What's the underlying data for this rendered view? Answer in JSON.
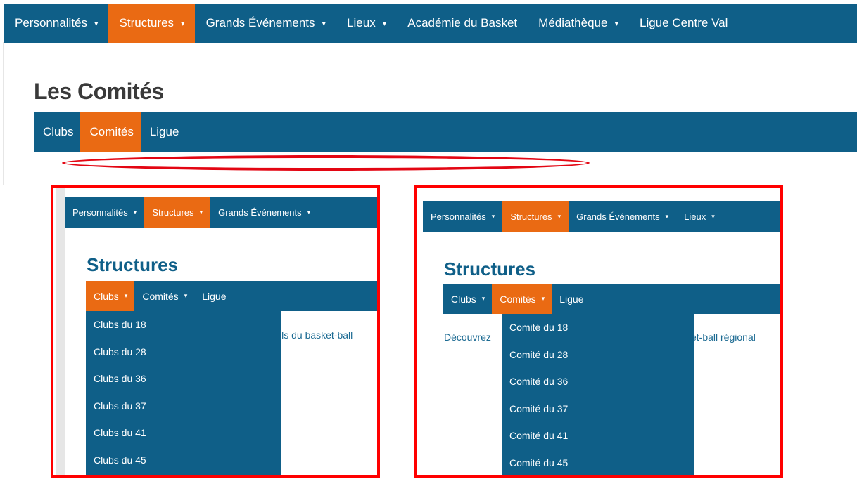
{
  "top_nav": {
    "items": [
      {
        "label": "Personnalités",
        "has_caret": true
      },
      {
        "label": "Structures",
        "has_caret": true,
        "active": true
      },
      {
        "label": "Grands Événements",
        "has_caret": true
      },
      {
        "label": "Lieux",
        "has_caret": true
      },
      {
        "label": "Académie du Basket",
        "has_caret": false
      },
      {
        "label": "Médiathèque",
        "has_caret": true
      },
      {
        "label": "Ligue Centre Val",
        "has_caret": false
      }
    ],
    "caret_glyph": "▾"
  },
  "page": {
    "title": "Les Comités",
    "sub_nav": [
      "Clubs",
      "Comités",
      "Ligue"
    ]
  },
  "panel_left": {
    "nav": [
      "Personnalités",
      "Structures",
      "Grands Événements"
    ],
    "title": "Structures",
    "sub_nav": [
      "Clubs",
      "Comités",
      "Ligue"
    ],
    "dropdown": [
      "Clubs du 18",
      "Clubs du 28",
      "Clubs du 36",
      "Clubs du 37",
      "Clubs du 41",
      "Clubs du 45"
    ],
    "body_text": "ils du basket-ball"
  },
  "panel_right": {
    "nav": [
      "Personnalités",
      "Structures",
      "Grands Événements",
      "Lieux"
    ],
    "title": "Structures",
    "sub_nav": [
      "Clubs",
      "Comités",
      "Ligue"
    ],
    "dropdown": [
      "Comité du 18",
      "Comité du 28",
      "Comité du 36",
      "Comité du 37",
      "Comité du 41",
      "Comité du 45"
    ],
    "body_text_left": "Découvrez",
    "body_text_right": "ket-ball régional"
  },
  "colors": {
    "nav_blue": "#0f5f88",
    "active_orange": "#ea6a13",
    "highlight_red": "#ff0000"
  }
}
